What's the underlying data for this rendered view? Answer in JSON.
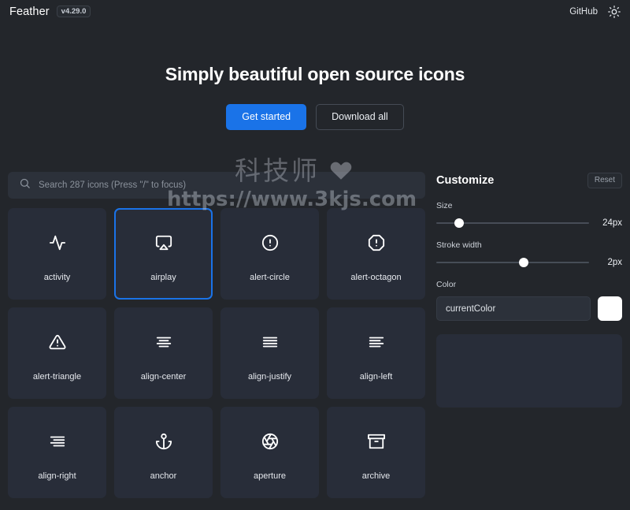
{
  "header": {
    "brand": "Feather",
    "version": "v4.29.0",
    "github_label": "GitHub",
    "theme_toggle_icon": "sun-icon"
  },
  "hero": {
    "title": "Simply beautiful open source icons",
    "primary_button": "Get started",
    "secondary_button": "Download all"
  },
  "search": {
    "placeholder": "Search 287 icons (Press \"/\" to focus)",
    "value": "",
    "icon": "search-icon",
    "icon_count": 287
  },
  "icons": [
    {
      "name": "activity",
      "selected": false
    },
    {
      "name": "airplay",
      "selected": true
    },
    {
      "name": "alert-circle",
      "selected": false
    },
    {
      "name": "alert-octagon",
      "selected": false
    },
    {
      "name": "alert-triangle",
      "selected": false
    },
    {
      "name": "align-center",
      "selected": false
    },
    {
      "name": "align-justify",
      "selected": false
    },
    {
      "name": "align-left",
      "selected": false
    },
    {
      "name": "align-right",
      "selected": false
    },
    {
      "name": "anchor",
      "selected": false
    },
    {
      "name": "aperture",
      "selected": false
    },
    {
      "name": "archive",
      "selected": false
    }
  ],
  "customize": {
    "title": "Customize",
    "reset_label": "Reset",
    "size": {
      "label": "Size",
      "value": "24px",
      "percent": 15
    },
    "stroke": {
      "label": "Stroke width",
      "value": "2px",
      "percent": 57
    },
    "color": {
      "label": "Color",
      "value": "currentColor",
      "swatch": "#ffffff"
    }
  },
  "watermark": {
    "text": "科技师",
    "url": "https://www.3kjs.com"
  },
  "colors": {
    "page_bg": "#23262b",
    "card_bg": "#282d39",
    "accent": "#1a73e8",
    "field_bg": "#2c313a"
  }
}
